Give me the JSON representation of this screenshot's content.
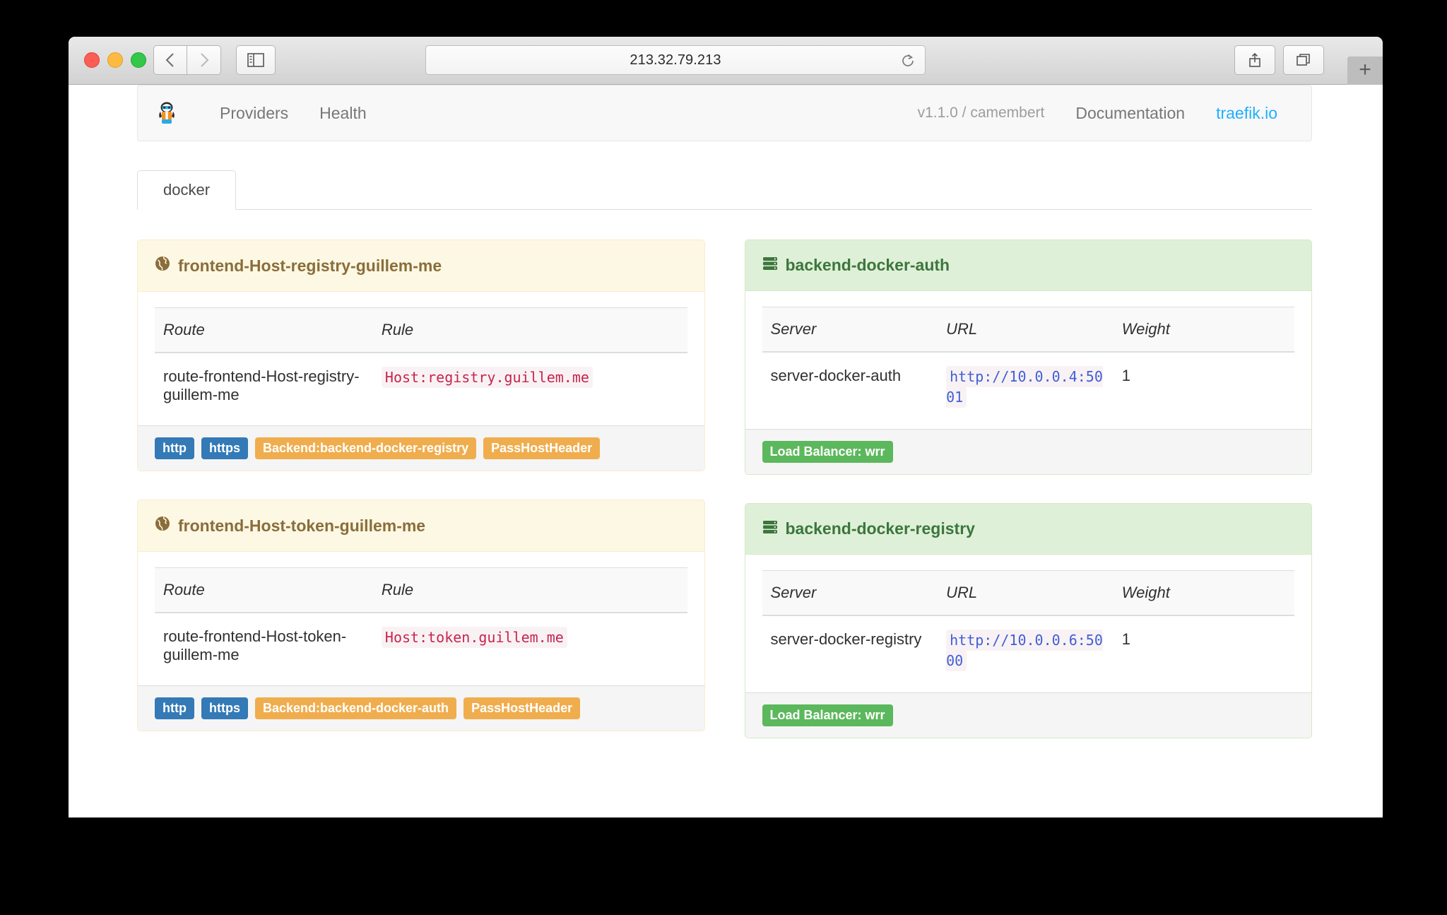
{
  "browser": {
    "url": "213.32.79.213",
    "controls": {
      "close": "close-window",
      "minimize": "minimize-window",
      "zoom": "zoom-window",
      "back": "back",
      "forward": "forward",
      "sidebar": "show-sidebar",
      "reload": "reload",
      "share": "share",
      "tabs": "show-all-tabs",
      "new_tab": "+"
    }
  },
  "navbar": {
    "brand": "traefik-logo",
    "links": [
      {
        "label": "Providers"
      },
      {
        "label": "Health"
      }
    ],
    "version": "v1.1.0 / camembert",
    "documentation": "Documentation",
    "site": "traefik.io",
    "site_color": "#1eb0ff"
  },
  "tabs": [
    {
      "label": "docker",
      "active": true
    }
  ],
  "colors": {
    "frontend_bg": "#fcf8e3",
    "frontend_text": "#8a6d3b",
    "frontend_border": "#faebcc",
    "backend_bg": "#dff0d8",
    "backend_text": "#3c763d",
    "backend_border": "#d6e9c6",
    "label_primary": "#337ab7",
    "label_warning": "#f0ad4e",
    "label_success": "#5cb85c",
    "code_text": "#c7254e",
    "code_bg": "#f9f2f4",
    "url_text": "#3f5fd6"
  },
  "frontends": [
    {
      "title": "frontend-Host-registry-guillem-me",
      "icon": "globe-icon",
      "headers": {
        "route": "Route",
        "rule": "Rule"
      },
      "rows": [
        {
          "route": "route-frontend-Host-registry-guillem-me",
          "rule": "Host:registry.guillem.me"
        }
      ],
      "labels": [
        {
          "text": "http",
          "style": "primary"
        },
        {
          "text": "https",
          "style": "primary"
        },
        {
          "text": "Backend:backend-docker-registry",
          "style": "warning"
        },
        {
          "text": "PassHostHeader",
          "style": "warning"
        }
      ]
    },
    {
      "title": "frontend-Host-token-guillem-me",
      "icon": "globe-icon",
      "headers": {
        "route": "Route",
        "rule": "Rule"
      },
      "rows": [
        {
          "route": "route-frontend-Host-token-guillem-me",
          "rule": "Host:token.guillem.me"
        }
      ],
      "labels": [
        {
          "text": "http",
          "style": "primary"
        },
        {
          "text": "https",
          "style": "primary"
        },
        {
          "text": "Backend:backend-docker-auth",
          "style": "warning"
        },
        {
          "text": "PassHostHeader",
          "style": "warning"
        }
      ]
    }
  ],
  "backends": [
    {
      "title": "backend-docker-auth",
      "icon": "server-stack-icon",
      "headers": {
        "server": "Server",
        "url": "URL",
        "weight": "Weight"
      },
      "rows": [
        {
          "server": "server-docker-auth",
          "url": "http://10.0.0.4:5001",
          "weight": "1"
        }
      ],
      "labels": [
        {
          "text": "Load Balancer: wrr",
          "style": "success"
        }
      ]
    },
    {
      "title": "backend-docker-registry",
      "icon": "server-stack-icon",
      "headers": {
        "server": "Server",
        "url": "URL",
        "weight": "Weight"
      },
      "rows": [
        {
          "server": "server-docker-registry",
          "url": "http://10.0.0.6:5000",
          "weight": "1"
        }
      ],
      "labels": [
        {
          "text": "Load Balancer: wrr",
          "style": "success"
        }
      ]
    }
  ]
}
